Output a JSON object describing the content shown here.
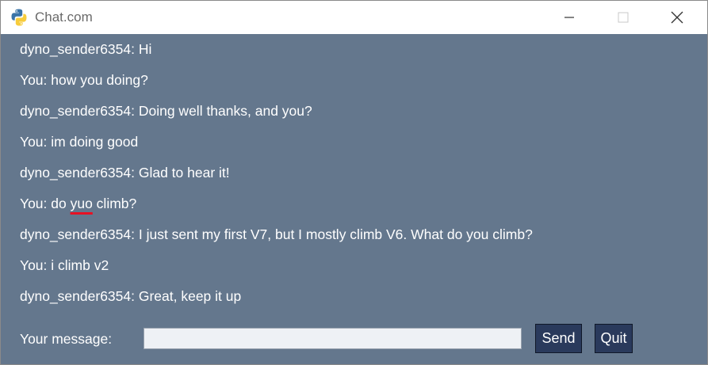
{
  "window": {
    "title": "Chat.com",
    "background": "#64778d"
  },
  "titlebar_buttons": [
    "minimize-icon",
    "maximize-icon",
    "close-icon"
  ],
  "messages": [
    {
      "text": "dyno_sender6354: Hi"
    },
    {
      "text": "You: how you doing?"
    },
    {
      "text": "dyno_sender6354: Doing well thanks, and you?"
    },
    {
      "text": "You: im doing good"
    },
    {
      "text": "dyno_sender6354: Glad to hear it!"
    },
    {
      "pre": "You: do ",
      "misspelled": "yuo",
      "post": " climb?"
    },
    {
      "text": "dyno_sender6354: I just sent my first V7, but I mostly climb V6. What do you climb?"
    },
    {
      "text": "You: i climb v2"
    },
    {
      "text": "dyno_sender6354: Great, keep it up"
    }
  ],
  "input": {
    "label": "Your message:",
    "value": "",
    "placeholder": ""
  },
  "buttons": {
    "send": "Send",
    "quit": "Quit"
  },
  "colors": {
    "button_bg": "#2a3a5c",
    "spellcheck_underline": "#e81123"
  }
}
